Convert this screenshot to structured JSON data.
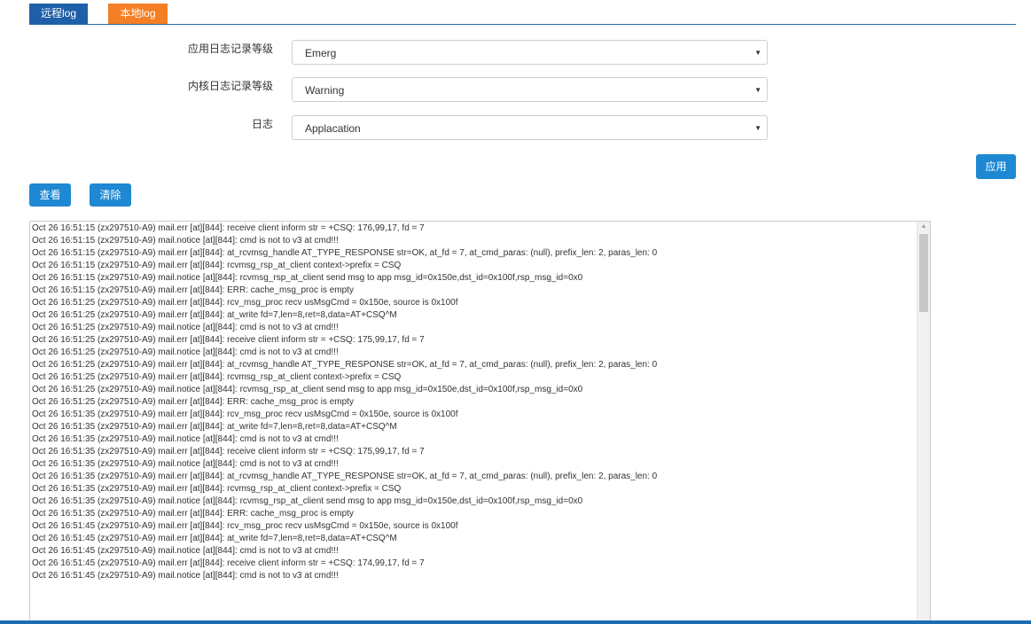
{
  "tabs": [
    {
      "label": "远程log"
    },
    {
      "label": "本地log"
    }
  ],
  "form": {
    "app_log_level": {
      "label": "应用日志记录等级",
      "value": "Emerg"
    },
    "kernel_log_level": {
      "label": "内核日志记录等级",
      "value": "Warning"
    },
    "log_type": {
      "label": "日志",
      "value": "Applacation"
    }
  },
  "buttons": {
    "apply": "应用",
    "view": "查看",
    "clear": "清除"
  },
  "log_lines": [
    "Oct 26 16:51:15 (zx297510-A9) mail.err [at][844]: receive client inform str = +CSQ: 176,99,17, fd = 7",
    "Oct 26 16:51:15 (zx297510-A9) mail.notice [at][844]: cmd is not to v3 at cmd!!!",
    "Oct 26 16:51:15 (zx297510-A9) mail.err [at][844]: at_rcvmsg_handle AT_TYPE_RESPONSE str=OK, at_fd = 7, at_cmd_paras: (null), prefix_len: 2, paras_len: 0",
    "Oct 26 16:51:15 (zx297510-A9) mail.err [at][844]: rcvmsg_rsp_at_client context->prefix = CSQ",
    "Oct 26 16:51:15 (zx297510-A9) mail.notice [at][844]: rcvmsg_rsp_at_client send msg to app msg_id=0x150e,dst_id=0x100f,rsp_msg_id=0x0",
    "Oct 26 16:51:15 (zx297510-A9) mail.err [at][844]: ERR: cache_msg_proc is empty",
    "Oct 26 16:51:25 (zx297510-A9) mail.err [at][844]: rcv_msg_proc recv usMsgCmd = 0x150e, source is 0x100f",
    "Oct 26 16:51:25 (zx297510-A9) mail.err [at][844]: at_write fd=7,len=8,ret=8,data=AT+CSQ^M",
    "Oct 26 16:51:25 (zx297510-A9) mail.notice [at][844]: cmd is not to v3 at cmd!!!",
    "Oct 26 16:51:25 (zx297510-A9) mail.err [at][844]: receive client inform str = +CSQ: 175,99,17, fd = 7",
    "Oct 26 16:51:25 (zx297510-A9) mail.notice [at][844]: cmd is not to v3 at cmd!!!",
    "Oct 26 16:51:25 (zx297510-A9) mail.err [at][844]: at_rcvmsg_handle AT_TYPE_RESPONSE str=OK, at_fd = 7, at_cmd_paras: (null), prefix_len: 2, paras_len: 0",
    "Oct 26 16:51:25 (zx297510-A9) mail.err [at][844]: rcvmsg_rsp_at_client context->prefix = CSQ",
    "Oct 26 16:51:25 (zx297510-A9) mail.notice [at][844]: rcvmsg_rsp_at_client send msg to app msg_id=0x150e,dst_id=0x100f,rsp_msg_id=0x0",
    "Oct 26 16:51:25 (zx297510-A9) mail.err [at][844]: ERR: cache_msg_proc is empty",
    "Oct 26 16:51:35 (zx297510-A9) mail.err [at][844]: rcv_msg_proc recv usMsgCmd = 0x150e, source is 0x100f",
    "Oct 26 16:51:35 (zx297510-A9) mail.err [at][844]: at_write fd=7,len=8,ret=8,data=AT+CSQ^M",
    "Oct 26 16:51:35 (zx297510-A9) mail.notice [at][844]: cmd is not to v3 at cmd!!!",
    "Oct 26 16:51:35 (zx297510-A9) mail.err [at][844]: receive client inform str = +CSQ: 175,99,17, fd = 7",
    "Oct 26 16:51:35 (zx297510-A9) mail.notice [at][844]: cmd is not to v3 at cmd!!!",
    "Oct 26 16:51:35 (zx297510-A9) mail.err [at][844]: at_rcvmsg_handle AT_TYPE_RESPONSE str=OK, at_fd = 7, at_cmd_paras: (null), prefix_len: 2, paras_len: 0",
    "Oct 26 16:51:35 (zx297510-A9) mail.err [at][844]: rcvmsg_rsp_at_client context->prefix = CSQ",
    "Oct 26 16:51:35 (zx297510-A9) mail.notice [at][844]: rcvmsg_rsp_at_client send msg to app msg_id=0x150e,dst_id=0x100f,rsp_msg_id=0x0",
    "Oct 26 16:51:35 (zx297510-A9) mail.err [at][844]: ERR: cache_msg_proc is empty",
    "Oct 26 16:51:45 (zx297510-A9) mail.err [at][844]: rcv_msg_proc recv usMsgCmd = 0x150e, source is 0x100f",
    "Oct 26 16:51:45 (zx297510-A9) mail.err [at][844]: at_write fd=7,len=8,ret=8,data=AT+CSQ^M",
    "Oct 26 16:51:45 (zx297510-A9) mail.notice [at][844]: cmd is not to v3 at cmd!!!",
    "Oct 26 16:51:45 (zx297510-A9) mail.err [at][844]: receive client inform str = +CSQ: 174,99,17, fd = 7",
    "Oct 26 16:51:45 (zx297510-A9) mail.notice [at][844]: cmd is not to v3 at cmd!!!"
  ],
  "colors": {
    "tab_remote": "#1f5fa8",
    "tab_local_active": "#f47f24",
    "button": "#1e88d2",
    "bottom_bar": "#1b6cb0"
  },
  "icons": {
    "select_arrow": "chevron-down-icon",
    "scroll_up": "scroll-up-arrow-icon"
  }
}
